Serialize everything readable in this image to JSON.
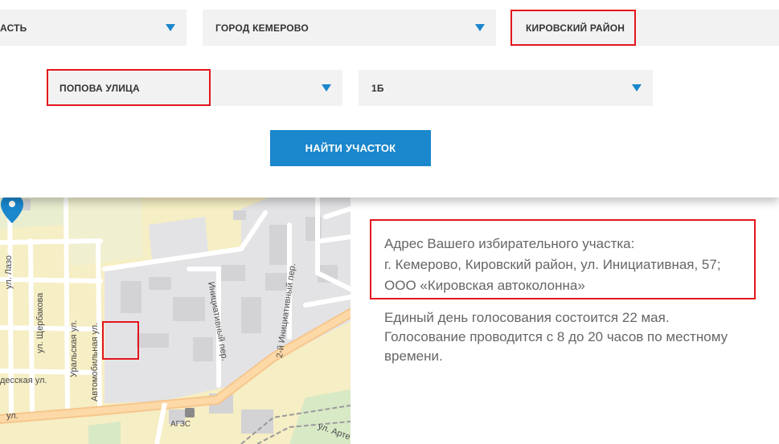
{
  "form": {
    "region_value": "АСТЬ",
    "city_value": "ГОРОД КЕМЕРОВО",
    "district_value": "КИРОВСКИЙ РАЙОН",
    "street_value": "ПОПОВА УЛИЦА",
    "house_value": "1Б",
    "find_button_label": "НАЙТИ УЧАСТОК"
  },
  "map": {
    "labels": {
      "lazo": "ул. Лазо",
      "shcherbakova": "ул. Щербакова",
      "uralskaya": "Уральская ул.",
      "avtomobilnaya": "Автомобильная ул.",
      "initsiativny": "Инициативный пер.",
      "initsiativny2": "2-й Инициативный пер.",
      "odesskaya": "десская ул.",
      "ul_bottom": "ул.",
      "ul_right": "ул. Арте",
      "agzs": "АГЗС"
    }
  },
  "info": {
    "address_title": "Адрес Вашего избирательного участка:",
    "address_line": "г. Кемерово, Кировский район, ул. Инициативная, 57;",
    "address_org": "ООО «Кировская автоколонна»",
    "vote_line1": "Единый день голосования состоится 22 мая.",
    "vote_line2": "Голосование проводится с 8 до 20 часов по местному",
    "vote_line3": "времени."
  },
  "colors": {
    "accent": "#1b87cc",
    "highlight": "#e3151c",
    "select_bg": "#f2f2f2"
  },
  "icons": {
    "dropdown": "chevron-down-icon",
    "map_pin": "map-pin-icon",
    "gas_station": "gas-station-icon"
  }
}
